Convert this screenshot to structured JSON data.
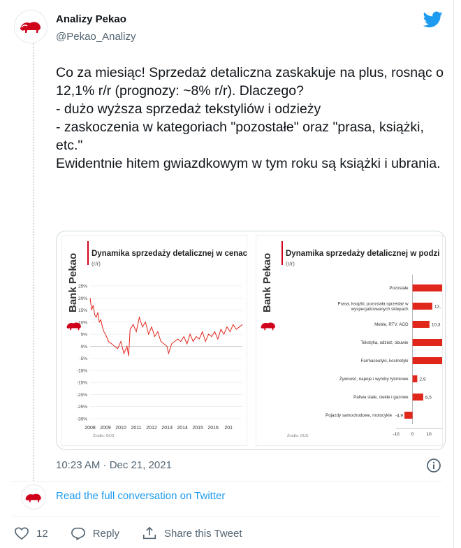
{
  "author": {
    "name": "Analizy Pekao",
    "handle": "@Pekao_Analizy"
  },
  "tweet": {
    "text": "Co za miesiąc! Sprzedaż detaliczna zaskakuje na plus, rosnąc o 12,1% r/r (prognozy: ~8% r/r). Dlaczego?\n- dużo wyższa sprzedaż tekstyliów i odzieży\n- zaskoczenia w kategoriach \"pozostałe\" oraz \"prasa, książki, etc.\"\nEwidentnie hitem gwiazdkowym w tym roku są książki i ubrania.",
    "timestamp": "10:23 AM · Dec 21, 2021"
  },
  "media": {
    "brand": "Bank Pekao",
    "source": "Źródło: GUS",
    "left_title": "Dynamika sprzedaży detalicznej w cenac",
    "right_title": "Dynamika sprzedaży detalicznej w podzi",
    "unit": "(r/r)"
  },
  "chart_data": [
    {
      "type": "line",
      "title": "Dynamika sprzedaży detalicznej w cenac",
      "ylabel": "(r/r)",
      "ylim": [
        -30,
        25
      ],
      "yticks": [
        "25%",
        "20%",
        "15%",
        "10%",
        "5%",
        "0%",
        "-5%",
        "-10%",
        "-15%",
        "-20%",
        "-25%",
        "-30%"
      ],
      "xticks": [
        "2008",
        "2009",
        "2010",
        "2011",
        "2012",
        "2013",
        "2014",
        "2015",
        "2016",
        "201"
      ],
      "series": [
        {
          "color": "#e1261c",
          "x": [
            2008.0,
            2008.1,
            2008.2,
            2008.3,
            2008.4,
            2008.5,
            2008.6,
            2008.7,
            2008.8,
            2008.9,
            2009.0,
            2009.2,
            2009.4,
            2009.6,
            2009.8,
            2010.0,
            2010.2,
            2010.4,
            2010.5,
            2010.6,
            2010.8,
            2011.0,
            2011.2,
            2011.4,
            2011.6,
            2011.8,
            2012.0,
            2012.2,
            2012.4,
            2012.6,
            2012.8,
            2013.0,
            2013.1,
            2013.3,
            2013.5,
            2013.7,
            2013.9,
            2014.1,
            2014.3,
            2014.5,
            2014.7,
            2014.9,
            2015.1,
            2015.3,
            2015.5,
            2015.7,
            2015.9,
            2016.1,
            2016.3,
            2016.5,
            2016.7,
            2016.9,
            2017.1,
            2017.3,
            2017.5,
            2017.7,
            2017.9
          ],
          "y": [
            20,
            15,
            17,
            13,
            12,
            14,
            10,
            11,
            8,
            6,
            5,
            2,
            1,
            0,
            -1,
            2,
            -3,
            0,
            -4,
            7,
            9,
            6,
            12,
            8,
            10,
            5,
            8,
            4,
            6,
            2,
            1,
            0,
            -3,
            1,
            2,
            3,
            2,
            4,
            1,
            5,
            2,
            4,
            3,
            6,
            2,
            5,
            4,
            6,
            3,
            7,
            5,
            8,
            6,
            9,
            7,
            8,
            9
          ]
        }
      ]
    },
    {
      "type": "bar",
      "title": "Dynamika sprzedaży detalicznej w podzi",
      "ylabel": "(r/r)",
      "categories": [
        "Pozostałe",
        "Prasa, książki, pozostała sprzedaż w wyspecjalizowanych sklepach",
        "Meble, RTV, AGD",
        "Tekstylia, odzież, obuwie",
        "Farmaceutyki, kosmetyki",
        "Żywność, napoje i wyroby tytoniowe",
        "Paliwa stałe, ciekłe i gazowe",
        "Pojazdy samochodowe, motocykle"
      ],
      "values": [
        30,
        12,
        10.3,
        30,
        30,
        2.9,
        6.5,
        -4.9
      ],
      "labels": [
        "",
        "12,",
        "10,3",
        "",
        "",
        "2,9",
        "6,5",
        "-4,9"
      ],
      "xticks": [
        "-10",
        "0",
        "10"
      ],
      "xlim": [
        -10,
        18
      ]
    }
  ],
  "link": {
    "label": "Read the full conversation on Twitter"
  },
  "actions": {
    "likes": "12",
    "reply": "Reply",
    "share": "Share this Tweet"
  }
}
